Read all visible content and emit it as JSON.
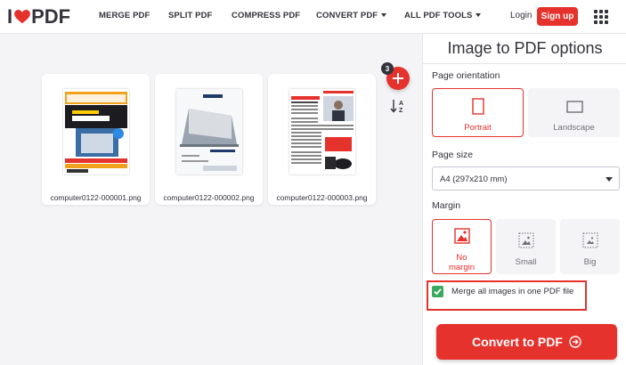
{
  "brand": {
    "logo_left": "I",
    "logo_right": "PDF",
    "accent": "#e5322d"
  },
  "nav": [
    {
      "label": "MERGE PDF"
    },
    {
      "label": "SPLIT PDF"
    },
    {
      "label": "COMPRESS PDF"
    },
    {
      "label": "CONVERT PDF"
    },
    {
      "label": "ALL PDF TOOLS"
    }
  ],
  "header": {
    "login_label": "Login",
    "signup_label": "Sign up"
  },
  "files": [
    {
      "name": "computer0122-000001.png"
    },
    {
      "name": "computer0122-000002.png"
    },
    {
      "name": "computer0122-000003.png"
    }
  ],
  "toolbar": {
    "file_count": "3"
  },
  "options": {
    "title": "Image to PDF options",
    "orientation_label": "Page orientation",
    "orientation": [
      {
        "label": "Portrait",
        "selected": true
      },
      {
        "label": "Landscape",
        "selected": false
      }
    ],
    "page_size_label": "Page size",
    "page_size_value": "A4 (297x210 mm)",
    "margin_label": "Margin",
    "margins": [
      {
        "line1": "No",
        "line2": "margin",
        "selected": true
      },
      {
        "line1": "Small",
        "line2": "",
        "selected": false
      },
      {
        "line1": "Big",
        "line2": "",
        "selected": false
      }
    ],
    "merge_label": "Merge all images in one PDF file",
    "merge_checked": true
  },
  "convert_label": "Convert to PDF"
}
